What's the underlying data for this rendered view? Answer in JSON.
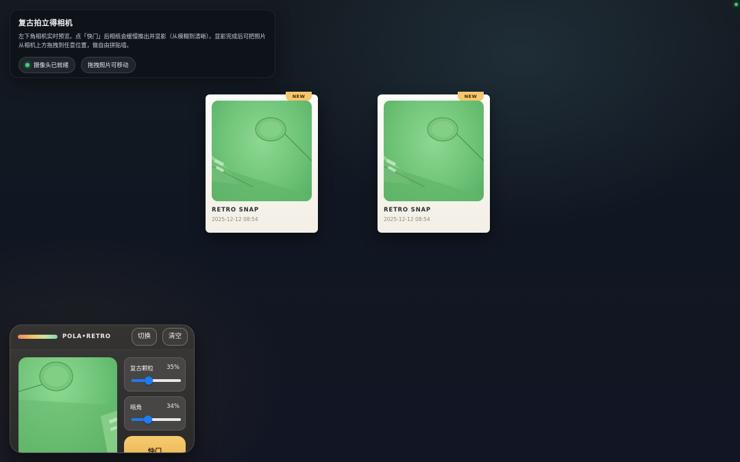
{
  "info": {
    "title": "复古拍立得相机",
    "description": "左下角相机实时预览。点「快门」后相纸会缓慢推出并显影（从模糊到清晰）。显影完成后可把照片从相机上方拖拽到任意位置，做自由拼贴墙。",
    "chips": [
      {
        "label": "摄像头已就绪",
        "status": "ready"
      },
      {
        "label": "拖拽照片可移动"
      }
    ]
  },
  "photos": [
    {
      "badge": "NEW",
      "caption": "RETRO SNAP",
      "date": "2025-12-12 08:54"
    },
    {
      "badge": "NEW",
      "caption": "RETRO SNAP",
      "date": "2025-12-12 08:54"
    }
  ],
  "camera": {
    "brand": "POLA•RETRO",
    "switch_label": "切换",
    "clear_label": "清空",
    "grain": {
      "label": "复古颗粒",
      "value_text": "35%",
      "value": 35
    },
    "vignette": {
      "label": "暗角",
      "value_text": "34%",
      "value": 34
    },
    "shutter_label": "快门"
  },
  "colors": {
    "accent": "#1d7bf5",
    "shutter": "#f2c265",
    "ready": "#3bd46e",
    "badge": "#f5c66d"
  }
}
